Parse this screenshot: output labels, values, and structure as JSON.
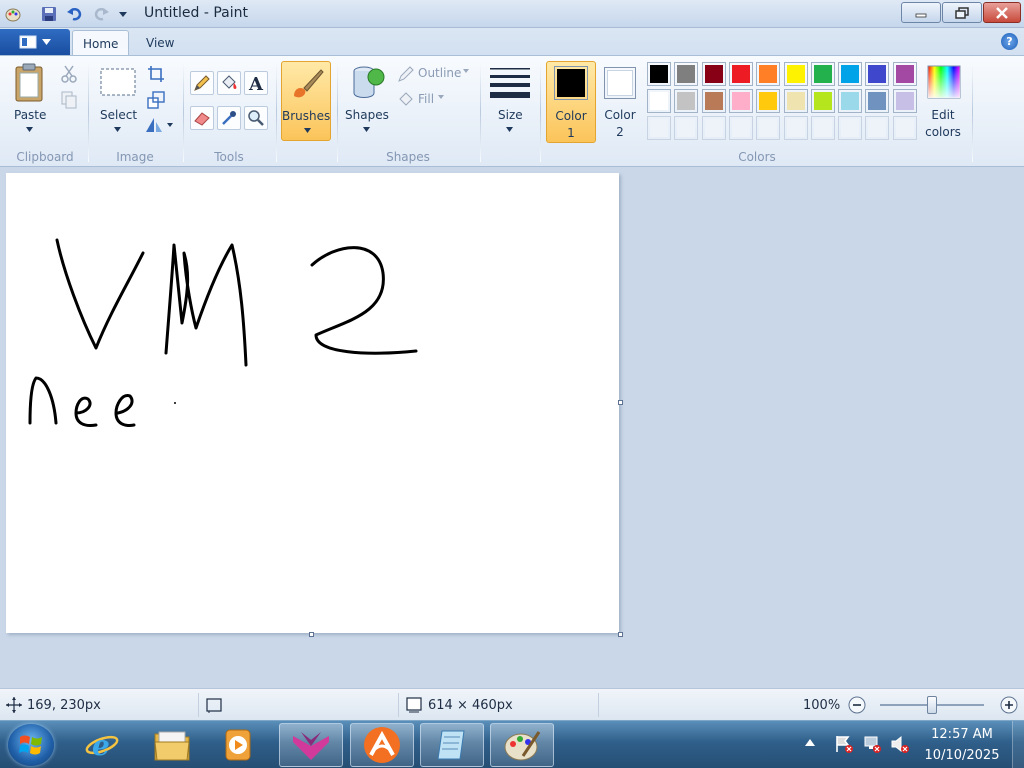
{
  "window": {
    "title": "Untitled - Paint"
  },
  "tabs": [
    {
      "label": "Home"
    },
    {
      "label": "View"
    }
  ],
  "ribbon": {
    "clipboard": {
      "group_label": "Clipboard",
      "paste_label": "Paste"
    },
    "image": {
      "group_label": "Image",
      "select_label": "Select"
    },
    "tools": {
      "group_label": "Tools"
    },
    "brushes": {
      "label": "Brushes"
    },
    "shapes": {
      "group_label": "Shapes",
      "shapes_label": "Shapes",
      "outline_label": "Outline",
      "fill_label": "Fill"
    },
    "size": {
      "label": "Size"
    },
    "colors": {
      "group_label": "Colors",
      "color1_label": "Color",
      "color1_num": "1",
      "color2_label": "Color",
      "color2_num": "2",
      "edit_label": "Edit",
      "edit_label2": "colors",
      "color1_value": "#000000",
      "color2_value": "#ffffff",
      "palette_row1": [
        "#000000",
        "#7f7f7f",
        "#880015",
        "#ed1c24",
        "#ff7f27",
        "#fff200",
        "#22b14c",
        "#00a2e8",
        "#3f48cc",
        "#a349a4"
      ],
      "palette_row2": [
        "#ffffff",
        "#c3c3c3",
        "#b97a57",
        "#ffaec9",
        "#ffc90e",
        "#efe4b0",
        "#b5e61d",
        "#99d9ea",
        "#7092be",
        "#c8bfe7"
      ],
      "palette_row3": [
        "",
        "",
        "",
        "",
        "",
        "",
        "",
        "",
        "",
        ""
      ]
    }
  },
  "status": {
    "cursor_position": "169, 230px",
    "selection_size": "",
    "canvas_size": "614 × 460px",
    "zoom": "100%",
    "zoom_level": 0.5
  },
  "taskbar": {
    "time": "12:57 AM",
    "date": "10/10/2025"
  }
}
